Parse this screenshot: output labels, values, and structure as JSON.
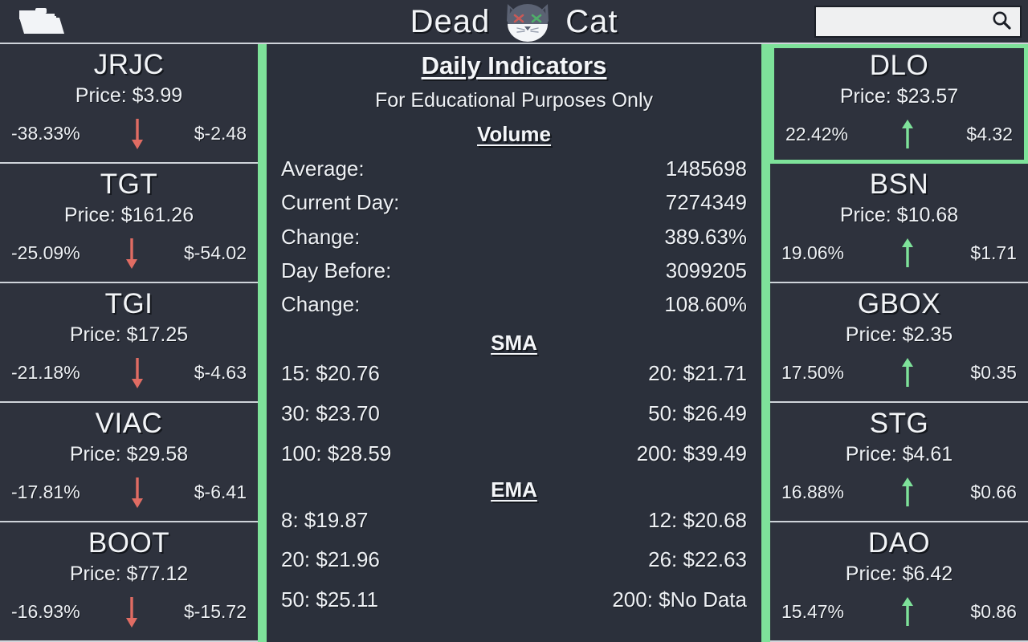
{
  "header": {
    "portfolio_icon": "folder-open-icon",
    "brand_left": "Dead",
    "brand_right": "Cat",
    "logo_icon": "dead-cat-icon",
    "search": {
      "value": "",
      "placeholder": "",
      "icon": "search-icon"
    }
  },
  "colors": {
    "background": "#2b303b",
    "card_background": "#2e323d",
    "accent_green": "#7ee29a",
    "down_red": "#e06c63",
    "border_light": "#cfd4da",
    "text": "#eef1f5"
  },
  "losers": {
    "direction_icon": "arrow-down-icon",
    "cards": [
      {
        "symbol": "JRJC",
        "price_label": "Price: $3.99",
        "percent": "-38.33%",
        "amount": "$-2.48",
        "selected": false
      },
      {
        "symbol": "TGT",
        "price_label": "Price: $161.26",
        "percent": "-25.09%",
        "amount": "$-54.02",
        "selected": false
      },
      {
        "symbol": "TGI",
        "price_label": "Price: $17.25",
        "percent": "-21.18%",
        "amount": "$-4.63",
        "selected": false
      },
      {
        "symbol": "VIAC",
        "price_label": "Price: $29.58",
        "percent": "-17.81%",
        "amount": "$-6.41",
        "selected": false
      },
      {
        "symbol": "BOOT",
        "price_label": "Price: $77.12",
        "percent": "-16.93%",
        "amount": "$-15.72",
        "selected": false
      }
    ]
  },
  "gainers": {
    "direction_icon": "arrow-up-icon",
    "cards": [
      {
        "symbol": "DLO",
        "price_label": "Price: $23.57",
        "percent": "22.42%",
        "amount": "$4.32",
        "selected": true
      },
      {
        "symbol": "BSN",
        "price_label": "Price: $10.68",
        "percent": "19.06%",
        "amount": "$1.71",
        "selected": false
      },
      {
        "symbol": "GBOX",
        "price_label": "Price: $2.35",
        "percent": "17.50%",
        "amount": "$0.35",
        "selected": false
      },
      {
        "symbol": "STG",
        "price_label": "Price: $4.61",
        "percent": "16.88%",
        "amount": "$0.66",
        "selected": false
      },
      {
        "symbol": "DAO",
        "price_label": "Price: $6.42",
        "percent": "15.47%",
        "amount": "$0.86",
        "selected": false
      }
    ]
  },
  "indicators": {
    "title": "Daily Indicators",
    "subtitle": "For Educational Purposes Only",
    "volume": {
      "heading": "Volume",
      "rows": [
        {
          "label": "Average:",
          "value": "1485698"
        },
        {
          "label": "Current Day:",
          "value": "7274349"
        },
        {
          "label": "Change:",
          "value": "389.63%"
        },
        {
          "label": "Day Before:",
          "value": "3099205"
        },
        {
          "label": "Change:",
          "value": "108.60%"
        }
      ]
    },
    "sma": {
      "heading": "SMA",
      "cells": [
        "15: $20.76",
        "20: $21.71",
        "30: $23.70",
        "50: $26.49",
        "100: $28.59",
        "200: $39.49"
      ]
    },
    "ema": {
      "heading": "EMA",
      "cells": [
        "8: $19.87",
        "12: $20.68",
        "20: $21.96",
        "26: $22.63",
        "50: $25.11",
        "200: $No Data"
      ]
    }
  }
}
